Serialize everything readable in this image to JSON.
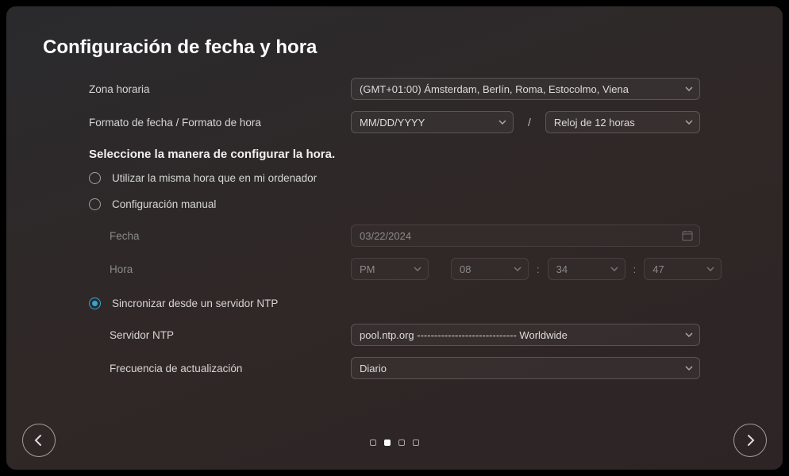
{
  "title": "Configuración de fecha y hora",
  "timezone": {
    "label": "Zona horaria",
    "value": "(GMT+01:00) Ámsterdam, Berlín, Roma, Estocolmo, Viena"
  },
  "format": {
    "label": "Formato de fecha / Formato de hora",
    "date_value": "MM/DD/YYYY",
    "separator": "/",
    "time_value": "Reloj de 12 horas"
  },
  "method": {
    "heading": "Seleccione la manera de configurar la hora.",
    "opt_same": "Utilizar la misma hora que en mi ordenador",
    "opt_manual": "Configuración manual",
    "opt_ntp": "Sincronizar desde un servidor NTP",
    "selected": "ntp"
  },
  "manual": {
    "date_label": "Fecha",
    "date_value": "03/22/2024",
    "time_label": "Hora",
    "meridiem": "PM",
    "hour": "08",
    "minute": "34",
    "second": "47"
  },
  "ntp": {
    "server_label": "Servidor NTP",
    "server_value": "pool.ntp.org ----------------------------- Worldwide",
    "freq_label": "Frecuencia de actualización",
    "freq_value": "Diario"
  },
  "pager": {
    "count": 4,
    "active": 1
  }
}
